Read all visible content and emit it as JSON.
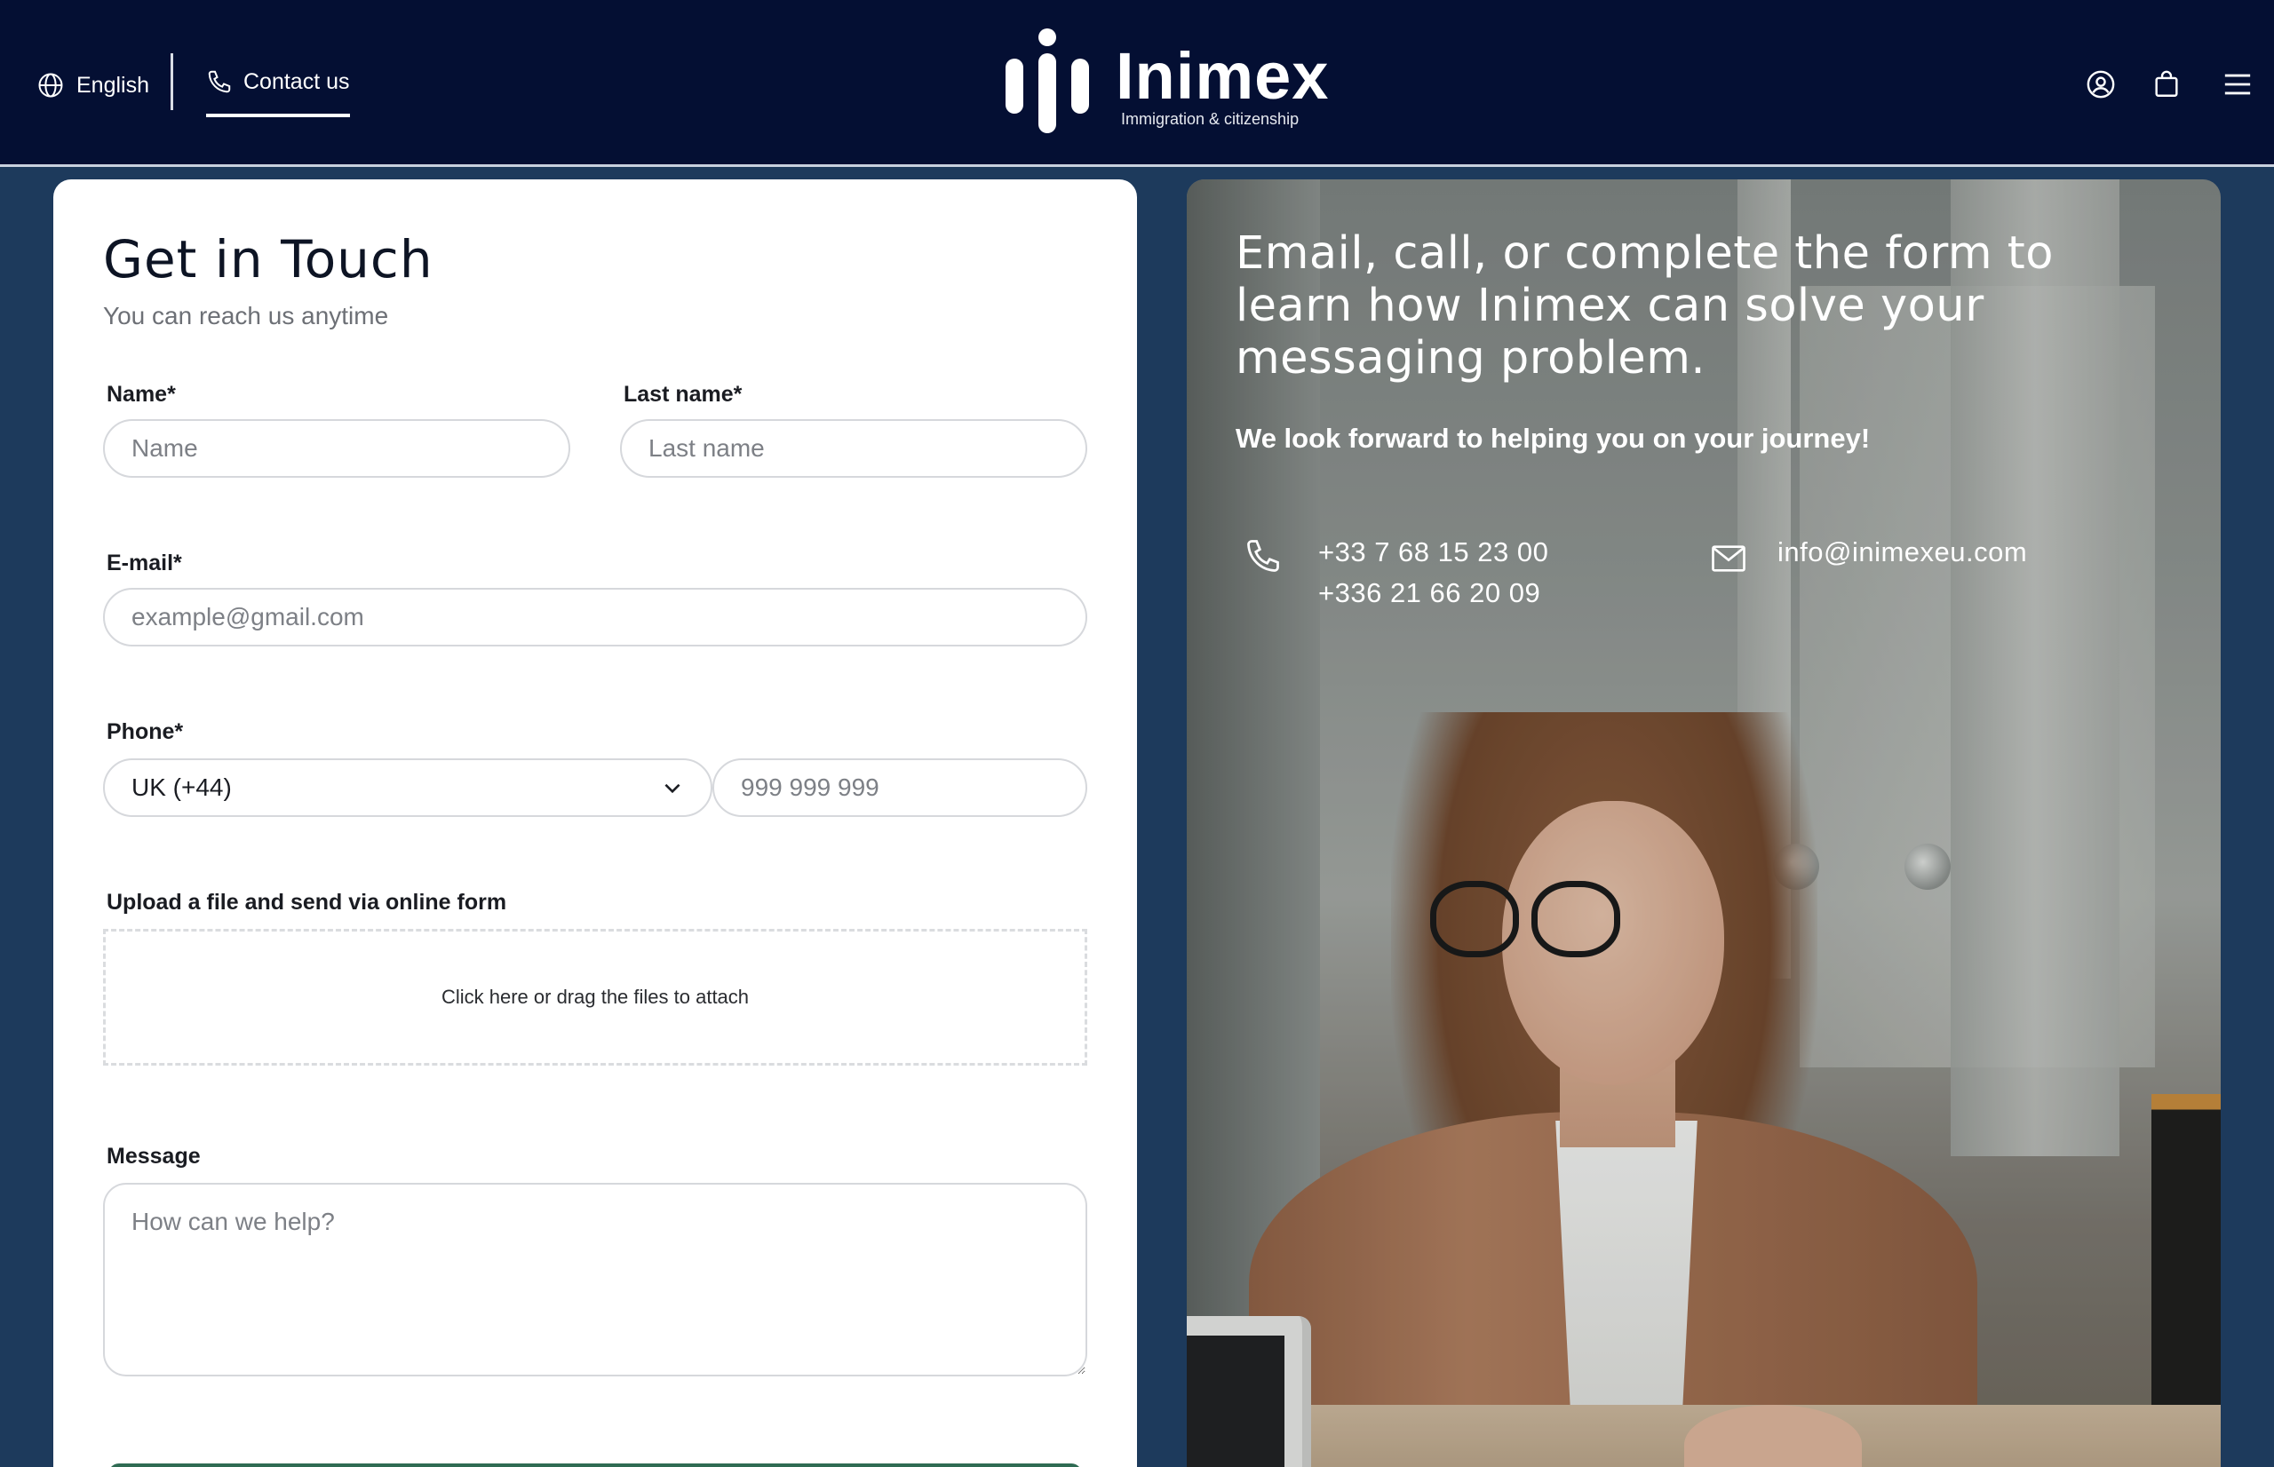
{
  "header": {
    "language_label": "English",
    "contact_label": "Contact us",
    "logo": {
      "name": "Inimex",
      "tagline": "Immigration & citizenship"
    },
    "icons": [
      "globe-icon",
      "phone-icon",
      "user-circle-icon",
      "shopping-bag-icon",
      "hamburger-menu-icon"
    ]
  },
  "form": {
    "title": "Get in Touch",
    "subtitle": "You can reach us anytime",
    "name": {
      "label": "Name*",
      "placeholder": "Name"
    },
    "last_name": {
      "label": "Last name*",
      "placeholder": "Last name"
    },
    "email": {
      "label": "E-mail*",
      "placeholder": "example@gmail.com"
    },
    "phone": {
      "label": "Phone*",
      "country_selected": "UK (+44)",
      "placeholder": "999 999 999"
    },
    "upload": {
      "label": "Upload a file and send via online form",
      "dropzone_text": "Click here or drag the files to attach"
    },
    "message": {
      "label": "Message",
      "placeholder": "How can we help?"
    }
  },
  "info_panel": {
    "heading": "Email, call, or complete the form to learn how Inimex can solve your messaging problem.",
    "subheading": "We look forward to helping you on your journey!",
    "phones": [
      "+33 7 68 15 23 00",
      "+336 21 66 20 09"
    ],
    "email": "info@inimexeu.com"
  },
  "colors": {
    "header_bg": "#040f33",
    "page_bg": "#1d3a5c",
    "card_bg": "#ffffff",
    "submit_accent": "#2f6b53"
  }
}
